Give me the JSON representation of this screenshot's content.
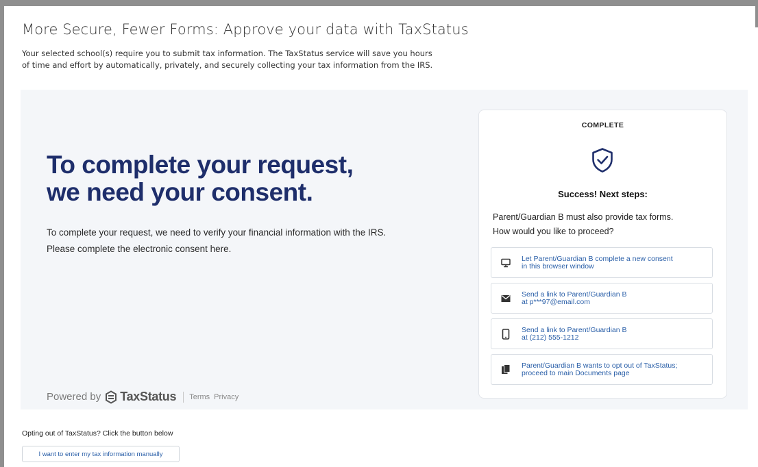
{
  "page": {
    "title": "More Secure, Fewer Forms: Approve your data with TaxStatus",
    "intro_line1": "Your selected school(s) require you to submit tax information. The TaxStatus service will save you hours",
    "intro_line2": "of time and effort by automatically, privately, and securely collecting your tax information from the IRS."
  },
  "hero": {
    "heading_line1": "To complete your request,",
    "heading_line2": "we need your consent.",
    "body_line1": "To complete your request, we need to verify your financial information with the IRS.",
    "body_line2": "Please complete the electronic consent here."
  },
  "footer": {
    "powered_by": "Powered by",
    "brand": "TaxStatus",
    "terms": "Terms",
    "privacy": "Privacy"
  },
  "card": {
    "status": "COMPLETE",
    "icon": "shield-check-icon",
    "success_title": "Success! Next steps:",
    "prompt_line1": "Parent/Guardian B must also provide tax forms.",
    "prompt_line2": "How would you like to proceed?",
    "options": [
      {
        "icon": "monitor-icon",
        "line1": "Let Parent/Guardian B complete a new consent",
        "line2": "in this browser window"
      },
      {
        "icon": "envelope-icon",
        "line1": "Send a link to Parent/Guardian B",
        "line2": "at p***97@email.com"
      },
      {
        "icon": "phone-icon",
        "line1": "Send a link to Parent/Guardian B",
        "line2": "at (212) 555-1212"
      },
      {
        "icon": "documents-icon",
        "line1": "Parent/Guardian B wants to opt out of TaxStatus;",
        "line2": "proceed to main Documents page"
      }
    ]
  },
  "optout": {
    "text": "Opting out of TaxStatus? Click the button below",
    "button_label": "I want to enter my tax information manually"
  },
  "colors": {
    "heading_navy": "#1e2e6b",
    "link_blue": "#2a5fa8",
    "panel_bg": "#f4f6f9"
  }
}
